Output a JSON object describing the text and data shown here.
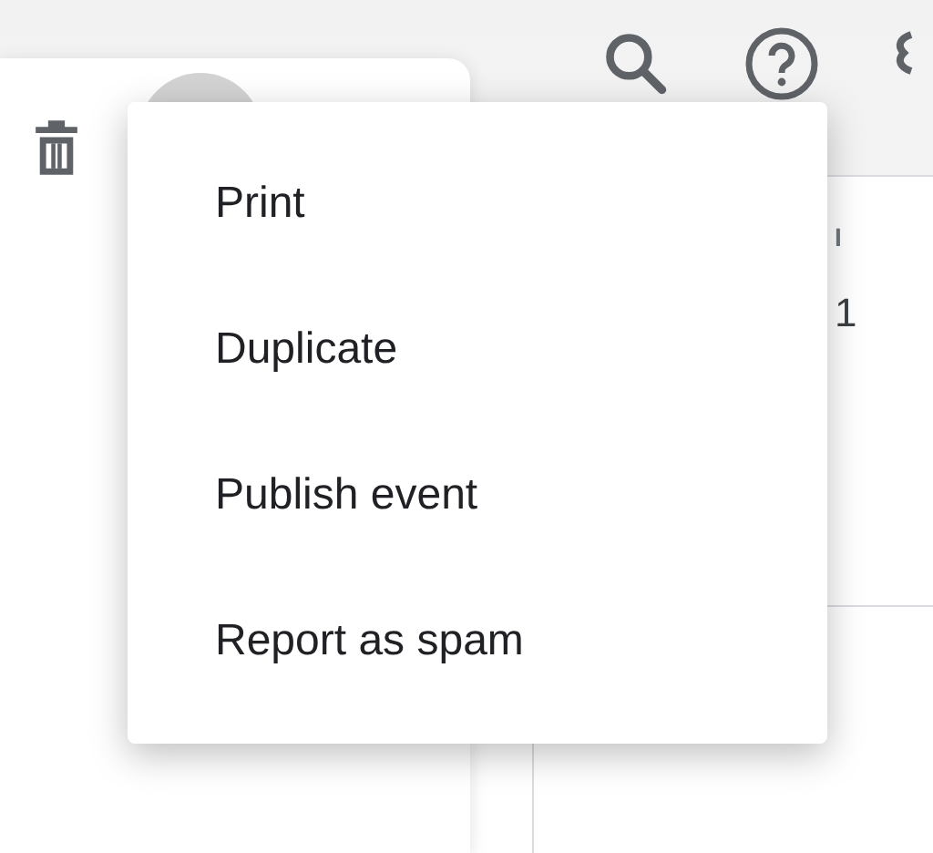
{
  "calendar": {
    "day_label": "I",
    "day_number": "1"
  },
  "menu": {
    "items": [
      {
        "label": "Print"
      },
      {
        "label": "Duplicate"
      },
      {
        "label": "Publish event"
      },
      {
        "label": "Report as spam"
      }
    ]
  }
}
